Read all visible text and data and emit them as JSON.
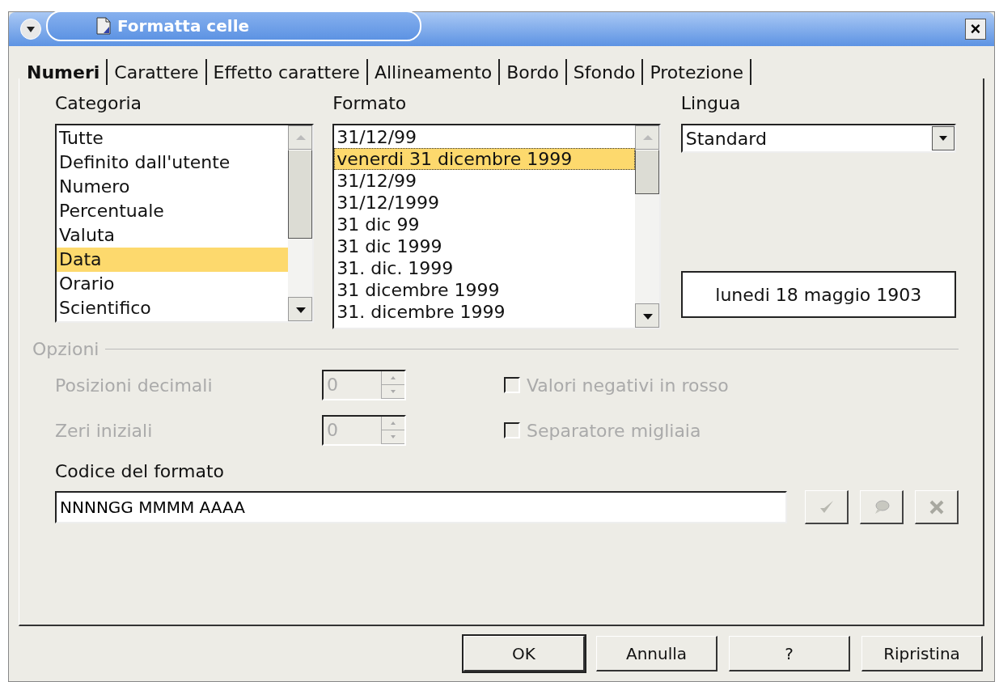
{
  "window": {
    "title": "Formatta celle",
    "close": "×"
  },
  "tabs": [
    {
      "label": "Numeri",
      "selected": true
    },
    {
      "label": "Carattere",
      "selected": false
    },
    {
      "label": "Effetto carattere",
      "selected": false
    },
    {
      "label": "Allineamento",
      "selected": false
    },
    {
      "label": "Bordo",
      "selected": false
    },
    {
      "label": "Sfondo",
      "selected": false
    },
    {
      "label": "Protezione",
      "selected": false
    }
  ],
  "categoria": {
    "label": "Categoria",
    "items": [
      {
        "label": "Tutte",
        "selected": false
      },
      {
        "label": "Definito dall'utente",
        "selected": false
      },
      {
        "label": "Numero",
        "selected": false
      },
      {
        "label": "Percentuale",
        "selected": false
      },
      {
        "label": "Valuta",
        "selected": false
      },
      {
        "label": "Data",
        "selected": true
      },
      {
        "label": "Orario",
        "selected": false
      },
      {
        "label": "Scientifico",
        "selected": false
      }
    ]
  },
  "formato": {
    "label": "Formato",
    "items": [
      {
        "label": "31/12/99",
        "selected": false
      },
      {
        "label": "venerdi 31 dicembre 1999",
        "selected": true
      },
      {
        "label": "31/12/99",
        "selected": false
      },
      {
        "label": "31/12/1999",
        "selected": false
      },
      {
        "label": "31 dic 99",
        "selected": false
      },
      {
        "label": "31 dic 1999",
        "selected": false
      },
      {
        "label": "31. dic. 1999",
        "selected": false
      },
      {
        "label": "31 dicembre 1999",
        "selected": false
      },
      {
        "label": "31. dicembre 1999",
        "selected": false
      }
    ]
  },
  "lingua": {
    "label": "Lingua",
    "value": "Standard"
  },
  "preview": "lunedi 18 maggio 1903",
  "opzioni": {
    "title": "Opzioni",
    "disabled": true,
    "spinners": [
      {
        "label": "Posizioni decimali",
        "value": "0"
      },
      {
        "label": "Zeri iniziali",
        "value": "0"
      }
    ],
    "checkboxes": [
      {
        "label": "Valori negativi in rosso",
        "checked": false
      },
      {
        "label": "Separatore migliaia",
        "checked": false
      }
    ]
  },
  "codice": {
    "label": "Codice del formato",
    "value": "NNNNGG MMMM AAAA"
  },
  "buttons": [
    {
      "label": "OK",
      "default": true
    },
    {
      "label": "Annulla",
      "default": false
    },
    {
      "label": "?",
      "default": false
    },
    {
      "label": "Ripristina",
      "default": false
    }
  ]
}
